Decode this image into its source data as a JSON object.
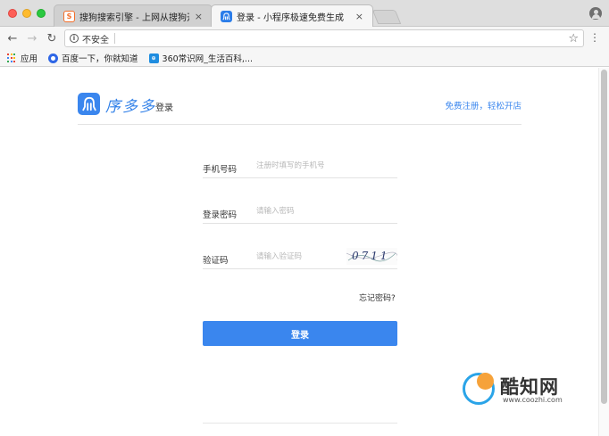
{
  "browser": {
    "tabs": [
      {
        "label": "搜狗搜索引擎 - 上网从搜狗开始",
        "close": "×",
        "active": false
      },
      {
        "label": "登录 - 小程序极速免费生成",
        "close": "×",
        "active": true
      }
    ],
    "address_bar": {
      "security": "不安全"
    },
    "bookmarks": [
      {
        "label": "应用"
      },
      {
        "label": "百度一下，你就知道"
      },
      {
        "label": "360常识网_生活百科,..."
      }
    ],
    "icons": [
      "arrow-left-icon",
      "arrow-right-icon",
      "reload-icon",
      "info-icon",
      "star-icon",
      "menu-dots-icon",
      "profile-icon"
    ]
  },
  "site": {
    "logo_text": "序多多",
    "header_title": "登录",
    "register_link": "免费注册，轻松开店",
    "accent_color": "#3a86ee"
  },
  "form": {
    "phone": {
      "label": "手机号码",
      "placeholder": "注册时填写的手机号"
    },
    "password": {
      "label": "登录密码",
      "placeholder": "请输入密码"
    },
    "captcha": {
      "label": "验证码",
      "placeholder": "请输入验证码",
      "image_text": "0711"
    },
    "forgot_link": "忘记密码?",
    "submit_label": "登录"
  },
  "watermark": {
    "title": "酷知网",
    "url": "www.coozhi.com"
  }
}
